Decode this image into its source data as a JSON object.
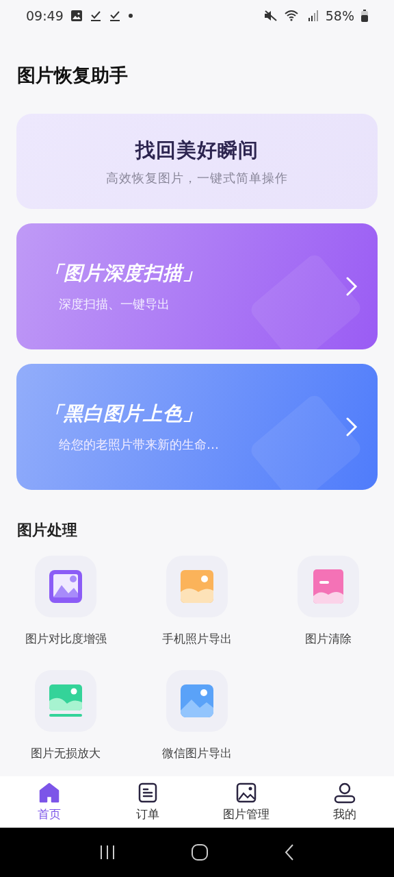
{
  "status_bar": {
    "time": "09:49",
    "battery": "58%"
  },
  "title": "图片恢复助手",
  "banner": {
    "headline": "找回美好瞬间",
    "subtitle": "高效恢复图片，一键式简单操作"
  },
  "feature_cards": [
    {
      "title": "「图片深度扫描」",
      "subtitle": "深度扫描、一键导出",
      "color": "#9a5cf4"
    },
    {
      "title": "「黑白图片上色」",
      "subtitle": "给您的老照片带来新的生命…",
      "color": "#4f7cfb"
    }
  ],
  "section_title": "图片处理",
  "tools": [
    {
      "label": "图片对比度增强",
      "kind": "contrast"
    },
    {
      "label": "手机照片导出",
      "kind": "export"
    },
    {
      "label": "图片清除",
      "kind": "clear"
    },
    {
      "label": "图片无损放大",
      "kind": "enlarge"
    },
    {
      "label": "微信图片导出",
      "kind": "wechat"
    }
  ],
  "tabs": [
    {
      "label": "首页",
      "kind": "home",
      "selected": true
    },
    {
      "label": "订单",
      "kind": "orders",
      "selected": false
    },
    {
      "label": "图片管理",
      "kind": "gallery",
      "selected": false
    },
    {
      "label": "我的",
      "kind": "profile",
      "selected": false
    }
  ]
}
